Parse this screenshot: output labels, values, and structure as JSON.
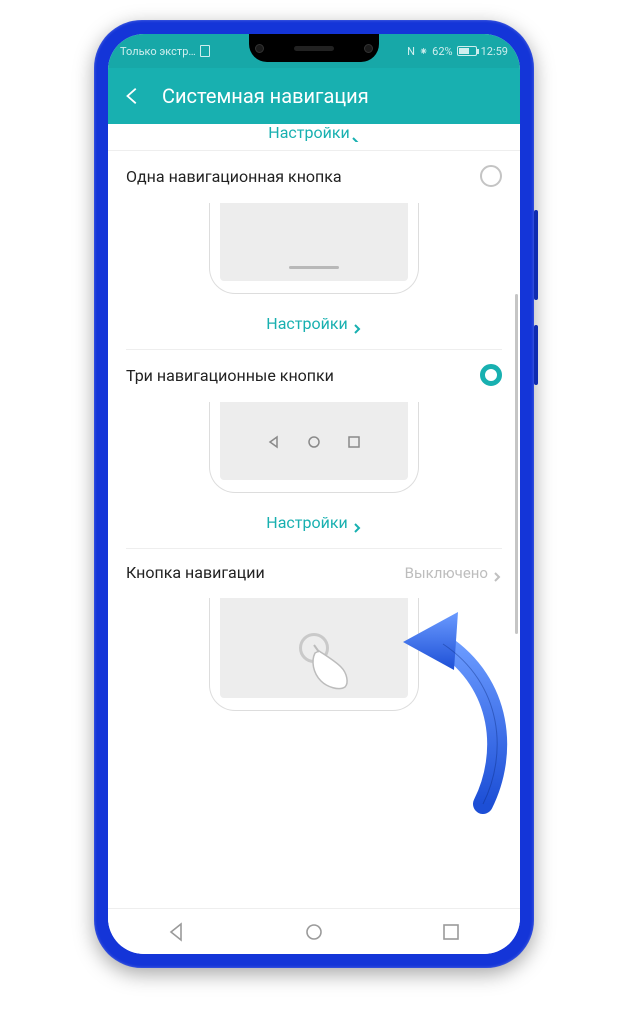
{
  "statusbar": {
    "carrier": "Только экстр…",
    "nfc": "N",
    "bluetooth": "⁕",
    "battery_pct": "62%",
    "time": "12:59"
  },
  "appbar": {
    "title": "Системная навигация"
  },
  "partial_top": {
    "label": "Настройки"
  },
  "option1": {
    "title": "Одна навигационная кнопка",
    "settings": "Настройки"
  },
  "option2": {
    "title": "Три навигационные кнопки",
    "settings": "Настройки"
  },
  "option3": {
    "title": "Кнопка навигации",
    "status": "Выключено"
  }
}
